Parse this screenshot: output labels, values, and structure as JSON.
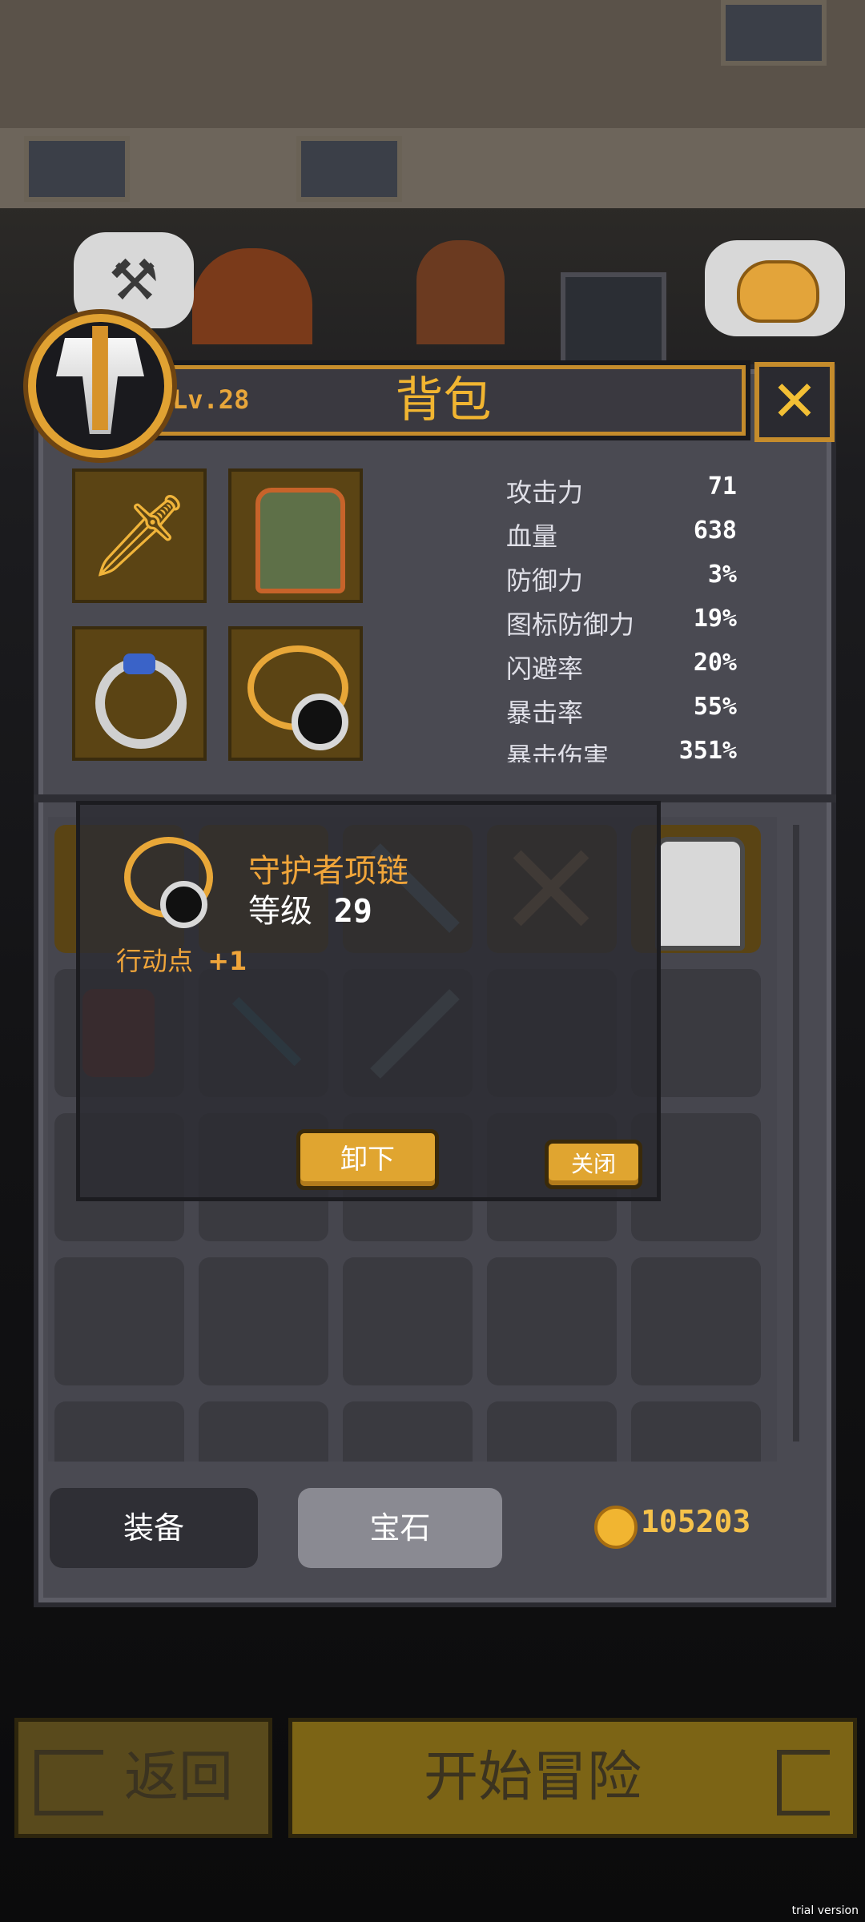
{
  "panel": {
    "title": "背包",
    "level": "Lv.28",
    "close_symbol": "✕"
  },
  "equipment": [
    {
      "slot": "weapon",
      "icon": "golden-sword-icon"
    },
    {
      "slot": "armor",
      "icon": "green-armor-icon"
    },
    {
      "slot": "ring",
      "icon": "silver-ring-icon"
    },
    {
      "slot": "necklace",
      "icon": "guardian-necklace-icon"
    }
  ],
  "stats": [
    {
      "label": "攻击力",
      "value": "71"
    },
    {
      "label": "血量",
      "value": "638"
    },
    {
      "label": "防御力",
      "value": "3%"
    },
    {
      "label": "图标防御力",
      "value": "19%"
    },
    {
      "label": "闪避率",
      "value": "20%"
    },
    {
      "label": "暴击率",
      "value": "55%"
    },
    {
      "label": "暴击伤害",
      "value": "351%"
    }
  ],
  "popup": {
    "item_name": "守护者项链",
    "level_label": "等级",
    "level_value": "29",
    "action_points_label": "行动点",
    "action_points_value": "+1",
    "unequip_label": "卸下",
    "close_label": "关闭"
  },
  "tabs": {
    "equipment": "装备",
    "gems": "宝石"
  },
  "currency": {
    "coins": "105203"
  },
  "bottom": {
    "back_label": "返回",
    "start_label": "开始冒险"
  },
  "watermark": "trial version",
  "colors": {
    "accent": "#f1b531",
    "panel": "#4a4a52",
    "highlight_text": "#f0a53a"
  }
}
